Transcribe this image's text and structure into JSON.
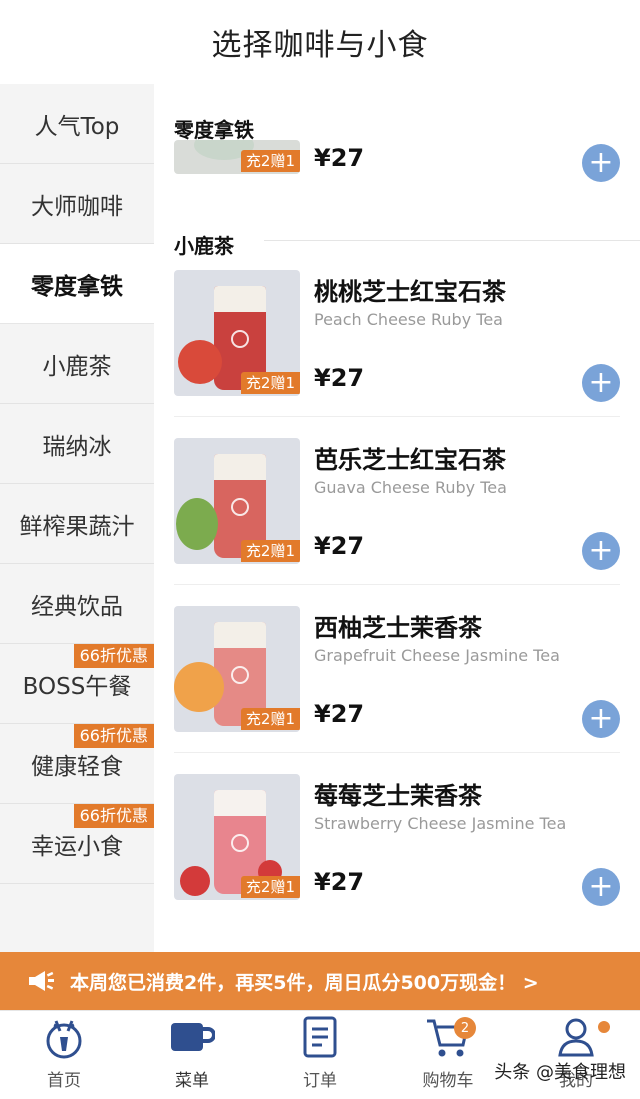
{
  "header": {
    "title": "选择咖啡与小食"
  },
  "sidebar": {
    "items": [
      {
        "label": "人气Top",
        "badge": ""
      },
      {
        "label": "大师咖啡",
        "badge": ""
      },
      {
        "label": "零度拿铁",
        "badge": "",
        "active": true
      },
      {
        "label": "小鹿茶",
        "badge": ""
      },
      {
        "label": "瑞纳冰",
        "badge": ""
      },
      {
        "label": "鲜榨果蔬汁",
        "badge": ""
      },
      {
        "label": "经典饮品",
        "badge": ""
      },
      {
        "label": "BOSS午餐",
        "badge": "66折优惠"
      },
      {
        "label": "健康轻食",
        "badge": "66折优惠"
      },
      {
        "label": "幸运小食",
        "badge": "66折优惠"
      }
    ]
  },
  "sections": [
    {
      "title": "零度拿铁"
    },
    {
      "title": "小鹿茶"
    }
  ],
  "top_item": {
    "promo": "充2赠1",
    "price": "¥27"
  },
  "products": [
    {
      "name": "桃桃芝士红宝石茶",
      "name_en": "Peach Cheese Ruby Tea",
      "price": "¥27",
      "promo": "充2赠1",
      "drink_color": "#c9413e",
      "fruit_color": "#d94a3a"
    },
    {
      "name": "芭乐芝士红宝石茶",
      "name_en": "Guava Cheese Ruby Tea",
      "price": "¥27",
      "promo": "充2赠1",
      "drink_color": "#d8655f",
      "fruit_color": "#7cab4e"
    },
    {
      "name": "西柚芝士茉香茶",
      "name_en": "Grapefruit Cheese Jasmine Tea",
      "price": "¥27",
      "promo": "充2赠1",
      "drink_color": "#e58a86",
      "fruit_color": "#f0a24a"
    },
    {
      "name": "莓莓芝士茉香茶",
      "name_en": "Strawberry Cheese Jasmine Tea",
      "price": "¥27",
      "promo": "充2赠1",
      "drink_color": "#e8858e",
      "fruit_color": "#d33a3a"
    }
  ],
  "banner": {
    "text": "本周您已消费2件，再买5件，周日瓜分500万现金！ >"
  },
  "tabbar": {
    "items": [
      {
        "label": "首页",
        "icon": "deer-icon"
      },
      {
        "label": "菜单",
        "icon": "cup-icon"
      },
      {
        "label": "订单",
        "icon": "order-icon"
      },
      {
        "label": "购物车",
        "icon": "cart-icon",
        "badge": "2"
      },
      {
        "label": "我的",
        "icon": "user-icon"
      }
    ]
  },
  "watermark": "头条 @美食理想",
  "colors": {
    "accent": "#e6873a",
    "add_button": "#7aa3d8",
    "icon_blue": "#2f4f8f"
  }
}
